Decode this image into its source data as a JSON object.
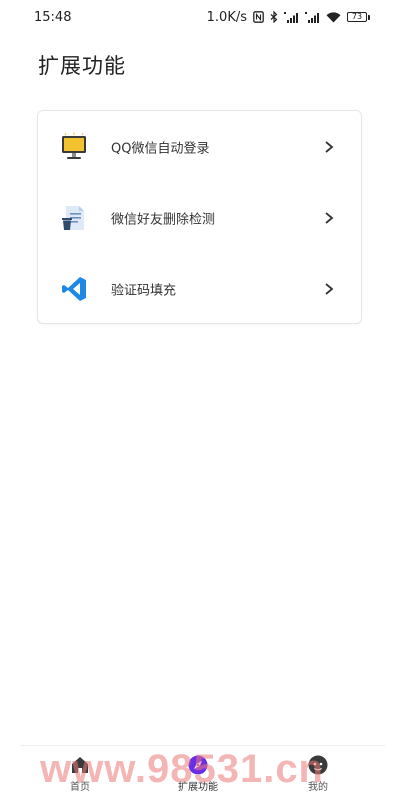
{
  "status_bar": {
    "time": "15:48",
    "network_speed": "1.0K/s",
    "battery": "73"
  },
  "page": {
    "title": "扩展功能"
  },
  "features": [
    {
      "label": "QQ微信自动登录",
      "icon": "computer-monitor-icon"
    },
    {
      "label": "微信好友删除检测",
      "icon": "document-trash-icon"
    },
    {
      "label": "验证码填充",
      "icon": "vscode-icon"
    }
  ],
  "bottom_nav": {
    "items": [
      {
        "label": "首页",
        "icon": "home-icon"
      },
      {
        "label": "扩展功能",
        "icon": "compass-icon",
        "active": true
      },
      {
        "label": "我的",
        "icon": "profile-icon"
      }
    ]
  },
  "watermark": "www.98531.cn",
  "colors": {
    "accent": "#6a2ee8",
    "vscode_blue": "#1e88e5",
    "monitor_yellow": "#f2c230"
  }
}
